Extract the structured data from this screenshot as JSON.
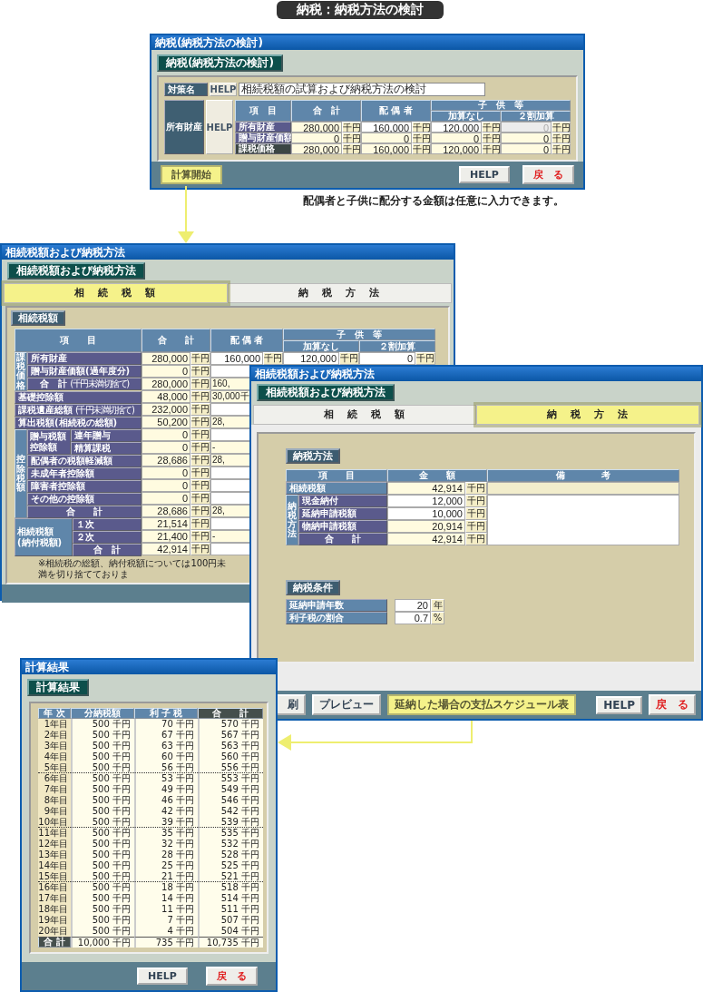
{
  "page_title": "納税：納税方法の検討",
  "window_1": {
    "title": "納税(納税方法の検討)",
    "heading": "納税(納税方法の検討)",
    "measure_label": "対策名",
    "measure_help": "HELP",
    "measure_name": "相続税額の試算および納税方法の検討",
    "property_label": "所有財産",
    "property_help": "HELP",
    "label_column": "項　目",
    "columns": [
      "合　計",
      "配 偶 者"
    ],
    "group_column": "子　供　等",
    "sub_columns": [
      "加算なし",
      "２割加算"
    ],
    "rows": [
      {
        "label": "所有財産",
        "kind": "item",
        "cells": [
          {
            "value": "280,000",
            "unit": "千円",
            "kind": "calc"
          },
          {
            "value": "160,000",
            "unit": "千円",
            "kind": "input"
          },
          {
            "value": "120,000",
            "unit": "千円",
            "kind": "input"
          },
          {
            "value": "0",
            "unit": "千円",
            "kind": "disabled"
          }
        ]
      },
      {
        "label": "贈与財産価額",
        "kind": "item",
        "cells": [
          {
            "value": "0",
            "unit": "千円",
            "kind": "calc"
          },
          {
            "value": "0",
            "unit": "千円",
            "kind": "calc"
          },
          {
            "value": "0",
            "unit": "千円",
            "kind": "calc"
          },
          {
            "value": "0",
            "unit": "千円",
            "kind": "calc"
          }
        ]
      },
      {
        "label": "課税価格",
        "kind": "total",
        "cells": [
          {
            "value": "280,000",
            "unit": "千円",
            "kind": "calc"
          },
          {
            "value": "160,000",
            "unit": "千円",
            "kind": "calc"
          },
          {
            "value": "120,000",
            "unit": "千円",
            "kind": "calc"
          },
          {
            "value": "0",
            "unit": "千円",
            "kind": "calc"
          }
        ]
      }
    ],
    "buttons": [
      {
        "label": "計算開始",
        "kind": "highlight"
      },
      {
        "label": "HELP",
        "kind": "help"
      },
      {
        "label": "戻　る",
        "kind": "back"
      }
    ]
  },
  "note": "配偶者と子供に配分する金額は任意に入力できます。",
  "window_2": {
    "title": "相続税額および納税方法",
    "heading": "相続税額および納税方法",
    "tabs": [
      {
        "label": "相　続　税　額",
        "selected": true
      },
      {
        "label": "納　税　方　法",
        "selected": false
      }
    ],
    "section_heading": "相続税額",
    "columns": [
      "項　　目",
      "合　　計",
      "配 偶 者"
    ],
    "group_column": "子　供　等",
    "sub_columns": [
      "加算なし",
      "２割加算"
    ],
    "sections": [
      {
        "kind": "group",
        "label": "課税価格",
        "rows": [
          {
            "label": "所有財産",
            "cells": [
              {
                "value": "280,000",
                "unit": "千円",
                "kind": "calc"
              },
              {
                "value": "160,000",
                "unit": "千円",
                "kind": "input"
              },
              {
                "value": "120,000",
                "unit": "千円",
                "kind": "input"
              },
              {
                "value": "0",
                "unit": "千円",
                "kind": "input"
              }
            ]
          },
          {
            "label": "贈与財産価額(過年度分)",
            "cells": [
              {
                "value": "0",
                "unit": "千円",
                "kind": "calc"
              }
            ]
          },
          {
            "label": "合　計",
            "note": "(千円未満切捨て)",
            "kind": "total",
            "cells": [
              {
                "value": "280,000",
                "unit": "千円",
                "kind": "calc"
              },
              {
                "value": "160,",
                "kind": "calc"
              }
            ]
          }
        ]
      },
      {
        "kind": "single",
        "label": "基礎控除額",
        "cells": [
          {
            "value": "48,000",
            "unit": "千円",
            "kind": "calc"
          },
          {
            "value": "30,000千",
            "kind": "calc"
          }
        ]
      },
      {
        "kind": "single",
        "label": "課税遺産総額",
        "note": "(千円未満切捨て)",
        "cells": [
          {
            "value": "232,000",
            "unit": "千円",
            "kind": "calc"
          }
        ]
      },
      {
        "kind": "single",
        "label": "算出税額(相続税の総額)",
        "cells": [
          {
            "value": "50,200",
            "unit": "千円",
            "kind": "calc"
          },
          {
            "value": "28,",
            "kind": "calc"
          }
        ]
      },
      {
        "kind": "group",
        "label": "控除税額",
        "rows": [
          {
            "kind": "subgroup",
            "label": "贈与税額控除額",
            "rows": [
              {
                "label": "連年贈与",
                "cells": [
                  {
                    "value": "0",
                    "unit": "千円",
                    "kind": "calc"
                  }
                ]
              },
              {
                "label": "精算課税",
                "cells": [
                  {
                    "value": "0",
                    "unit": "千円",
                    "kind": "calc"
                  },
                  {
                    "value": "-",
                    "kind": "calc"
                  }
                ]
              }
            ]
          },
          {
            "label": "配偶者の税額軽減額",
            "cells": [
              {
                "value": "28,686",
                "unit": "千円",
                "kind": "calc"
              },
              {
                "value": "28,",
                "kind": "calc"
              }
            ]
          },
          {
            "label": "未成年者控除額",
            "cells": [
              {
                "value": "0",
                "unit": "千円",
                "kind": "calc"
              }
            ]
          },
          {
            "label": "障害者控除額",
            "cells": [
              {
                "value": "0",
                "unit": "千円",
                "kind": "calc"
              }
            ]
          },
          {
            "label": "その他の控除額",
            "cells": [
              {
                "value": "0",
                "unit": "千円",
                "kind": "calc"
              }
            ]
          },
          {
            "label": "合　　計",
            "kind": "total",
            "cells": [
              {
                "value": "28,686",
                "unit": "千円",
                "kind": "calc"
              },
              {
                "value": "28,",
                "kind": "calc"
              }
            ]
          }
        ]
      },
      {
        "kind": "wide_group",
        "label": "相続税額(納付税額)",
        "rows": [
          {
            "label": "１次",
            "cells": [
              {
                "value": "21,514",
                "unit": "千円",
                "kind": "calc"
              }
            ]
          },
          {
            "label": "２次",
            "cells": [
              {
                "value": "21,400",
                "unit": "千円",
                "kind": "calc"
              },
              {
                "value": "-",
                "kind": "calc"
              }
            ]
          },
          {
            "label": "合　計",
            "kind": "total",
            "cells": [
              {
                "value": "42,914",
                "unit": "千円",
                "kind": "calc"
              }
            ]
          }
        ]
      }
    ],
    "footnote": "※相続税の総額、納付税額については100円未満を切り捨てておりま"
  },
  "window_3": {
    "title": "相続税額および納税方法",
    "heading": "相続税額および納税方法",
    "tabs": [
      {
        "label": "相　続　税　額",
        "selected": false
      },
      {
        "label": "納　税　方　法",
        "selected": true
      }
    ],
    "method_heading": "納税方法",
    "columns": [
      "項　　目",
      "金　　額",
      "備　　　　考"
    ],
    "tax_row": {
      "label": "相続税額",
      "value": "42,914",
      "unit": "千円",
      "kind": "calc"
    },
    "method_group": "納税方法",
    "method_rows": [
      {
        "label": "現金納付",
        "value": "12,000",
        "unit": "千円",
        "kind": "input"
      },
      {
        "label": "延納申請税額",
        "value": "10,000",
        "unit": "千円",
        "kind": "input"
      },
      {
        "label": "物納申請税額",
        "value": "20,914",
        "unit": "千円",
        "kind": "calc"
      },
      {
        "label": "合　　計",
        "value": "42,914",
        "unit": "千円",
        "kind": "total"
      }
    ],
    "conditions_heading": "納税条件",
    "conditions": [
      {
        "label": "延納申請年数",
        "value": "20",
        "unit": "年"
      },
      {
        "label": "利子税の割合",
        "value": "0.7",
        "unit": "%"
      }
    ],
    "buttons": [
      {
        "label": "刷",
        "kind": "cut"
      },
      {
        "label": "プレビュー",
        "kind": "normal"
      },
      {
        "label": "延納した場合の支払スケジュール表",
        "kind": "highlight"
      },
      {
        "label": "HELP",
        "kind": "help"
      },
      {
        "label": "戻　る",
        "kind": "back"
      }
    ]
  },
  "window_4": {
    "title": "計算結果",
    "heading": "計算結果",
    "columns": [
      {
        "label": "年 次",
        "kind": "normal"
      },
      {
        "label": "分納税額",
        "kind": "normal"
      },
      {
        "label": "利 子 税",
        "kind": "normal"
      },
      {
        "label": "合　　計",
        "kind": "total"
      }
    ],
    "rows": [
      [
        "1年目",
        "500 千円",
        "70 千円",
        "570 千円"
      ],
      [
        "2年目",
        "500 千円",
        "67 千円",
        "567 千円"
      ],
      [
        "3年目",
        "500 千円",
        "63 千円",
        "563 千円"
      ],
      [
        "4年目",
        "500 千円",
        "60 千円",
        "560 千円"
      ],
      [
        "5年目",
        "500 千円",
        "56 千円",
        "556 千円"
      ],
      [
        "6年目",
        "500 千円",
        "53 千円",
        "553 千円"
      ],
      [
        "7年目",
        "500 千円",
        "49 千円",
        "549 千円"
      ],
      [
        "8年目",
        "500 千円",
        "46 千円",
        "546 千円"
      ],
      [
        "9年目",
        "500 千円",
        "42 千円",
        "542 千円"
      ],
      [
        "10年目",
        "500 千円",
        "39 千円",
        "539 千円"
      ],
      [
        "11年目",
        "500 千円",
        "35 千円",
        "535 千円"
      ],
      [
        "12年目",
        "500 千円",
        "32 千円",
        "532 千円"
      ],
      [
        "13年目",
        "500 千円",
        "28 千円",
        "528 千円"
      ],
      [
        "14年目",
        "500 千円",
        "25 千円",
        "525 千円"
      ],
      [
        "15年目",
        "500 千円",
        "21 千円",
        "521 千円"
      ],
      [
        "16年目",
        "500 千円",
        "18 千円",
        "518 千円"
      ],
      [
        "17年目",
        "500 千円",
        "14 千円",
        "514 千円"
      ],
      [
        "18年目",
        "500 千円",
        "11 千円",
        "511 千円"
      ],
      [
        "19年目",
        "500 千円",
        "7 千円",
        "507 千円"
      ],
      [
        "20年目",
        "500 千円",
        "4 千円",
        "504 千円"
      ]
    ],
    "total_row": [
      "合 計",
      "10,000 千円",
      "735 千円",
      "10,735 千円"
    ],
    "buttons": [
      {
        "label": "HELP",
        "kind": "help"
      },
      {
        "label": "戻　る",
        "kind": "back"
      }
    ]
  }
}
